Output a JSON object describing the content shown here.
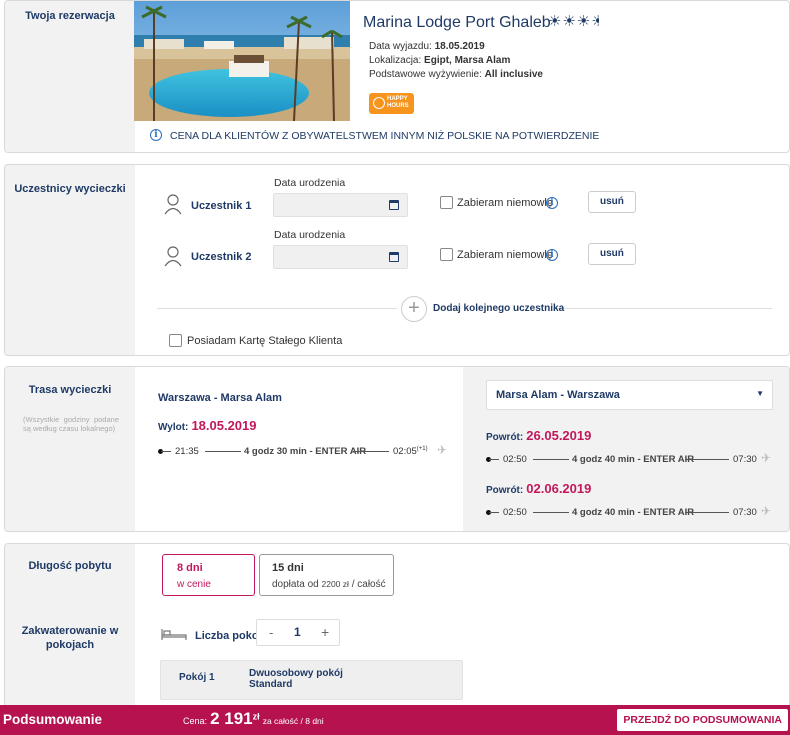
{
  "reservation": {
    "side_title": "Twoja rezerwacja",
    "hotel_name": "Marina Lodge Port Ghaleb",
    "departure_label": "Data wyjazdu:",
    "departure_value": "18.05.2019",
    "location_label": "Lokalizacja:",
    "location_value": "Egipt, Marsa Alam",
    "board_label": "Podstawowe wyżywienie:",
    "board_value": "All inclusive",
    "badge_line1": "HAPPY",
    "badge_line2": "HOURS",
    "notice": "CENA DLA KLIENTÓW Z OBYWATELSTWEM INNYM NIŻ POLSKIE NA POTWIERDZENIE",
    "colors": {
      "accent": "#1f3a66",
      "badge": "#f7941d"
    }
  },
  "participants": {
    "side_title": "Uczestnicy wycieczki",
    "list": [
      {
        "name": "Uczestnik 1",
        "dob_label": "Data urodzenia",
        "infant_label": "Zabieram niemowlę",
        "remove_label": "usuń"
      },
      {
        "name": "Uczestnik 2",
        "dob_label": "Data urodzenia",
        "infant_label": "Zabieram niemowlę",
        "remove_label": "usuń"
      }
    ],
    "add_label": "Dodaj kolejnego uczestnika",
    "card_label": "Posiadam Kartę Stałego Klienta"
  },
  "route": {
    "side_title": "Trasa wycieczki",
    "side_note": "(Wszystkie godziny podane są według czasu lokalnego)",
    "outbound": {
      "title": "Warszawa - Marsa Alam",
      "date_label": "Wylot:",
      "date_value": "18.05.2019",
      "dep": "21:35",
      "info": "4 godz 30 min - ENTER AIR",
      "arr": "02:05",
      "arr_sup": "(+1)"
    },
    "return_select": "Marsa Alam - Warszawa",
    "returns": [
      {
        "date_label": "Powrót:",
        "date_value": "26.05.2019",
        "dep": "02:50",
        "info": "4 godz 40 min - ENTER AIR",
        "arr": "07:30"
      },
      {
        "date_label": "Powrót:",
        "date_value": "02.06.2019",
        "dep": "02:50",
        "info": "4 godz 40 min - ENTER AIR",
        "arr": "07:30"
      }
    ]
  },
  "stay": {
    "side_title": "Długość pobytu",
    "options": [
      {
        "title": "8 dni",
        "sub": "w cenie"
      },
      {
        "title": "15 dni",
        "sub_prefix": "dopłata od",
        "sub_amount": "2200 zł",
        "sub_suffix": "/ całość"
      }
    ],
    "rooms_side_title": "Zakwaterowanie w pokojach",
    "rooms_label": "Liczba pokoi",
    "rooms_minus": "-",
    "rooms_count": "1",
    "rooms_plus": "+",
    "room_name": "Pokój 1",
    "room_type": "Dwuosobowy pokój Standard"
  },
  "summary": {
    "title": "Podsumowanie",
    "price_label": "Cena:",
    "price_value": "2 191",
    "price_currency": "zł",
    "price_note": "za całość / 8 dni",
    "cta": "PRZEJDŹ DO PODSUMOWANIA",
    "bar_color": "#b5124f"
  }
}
